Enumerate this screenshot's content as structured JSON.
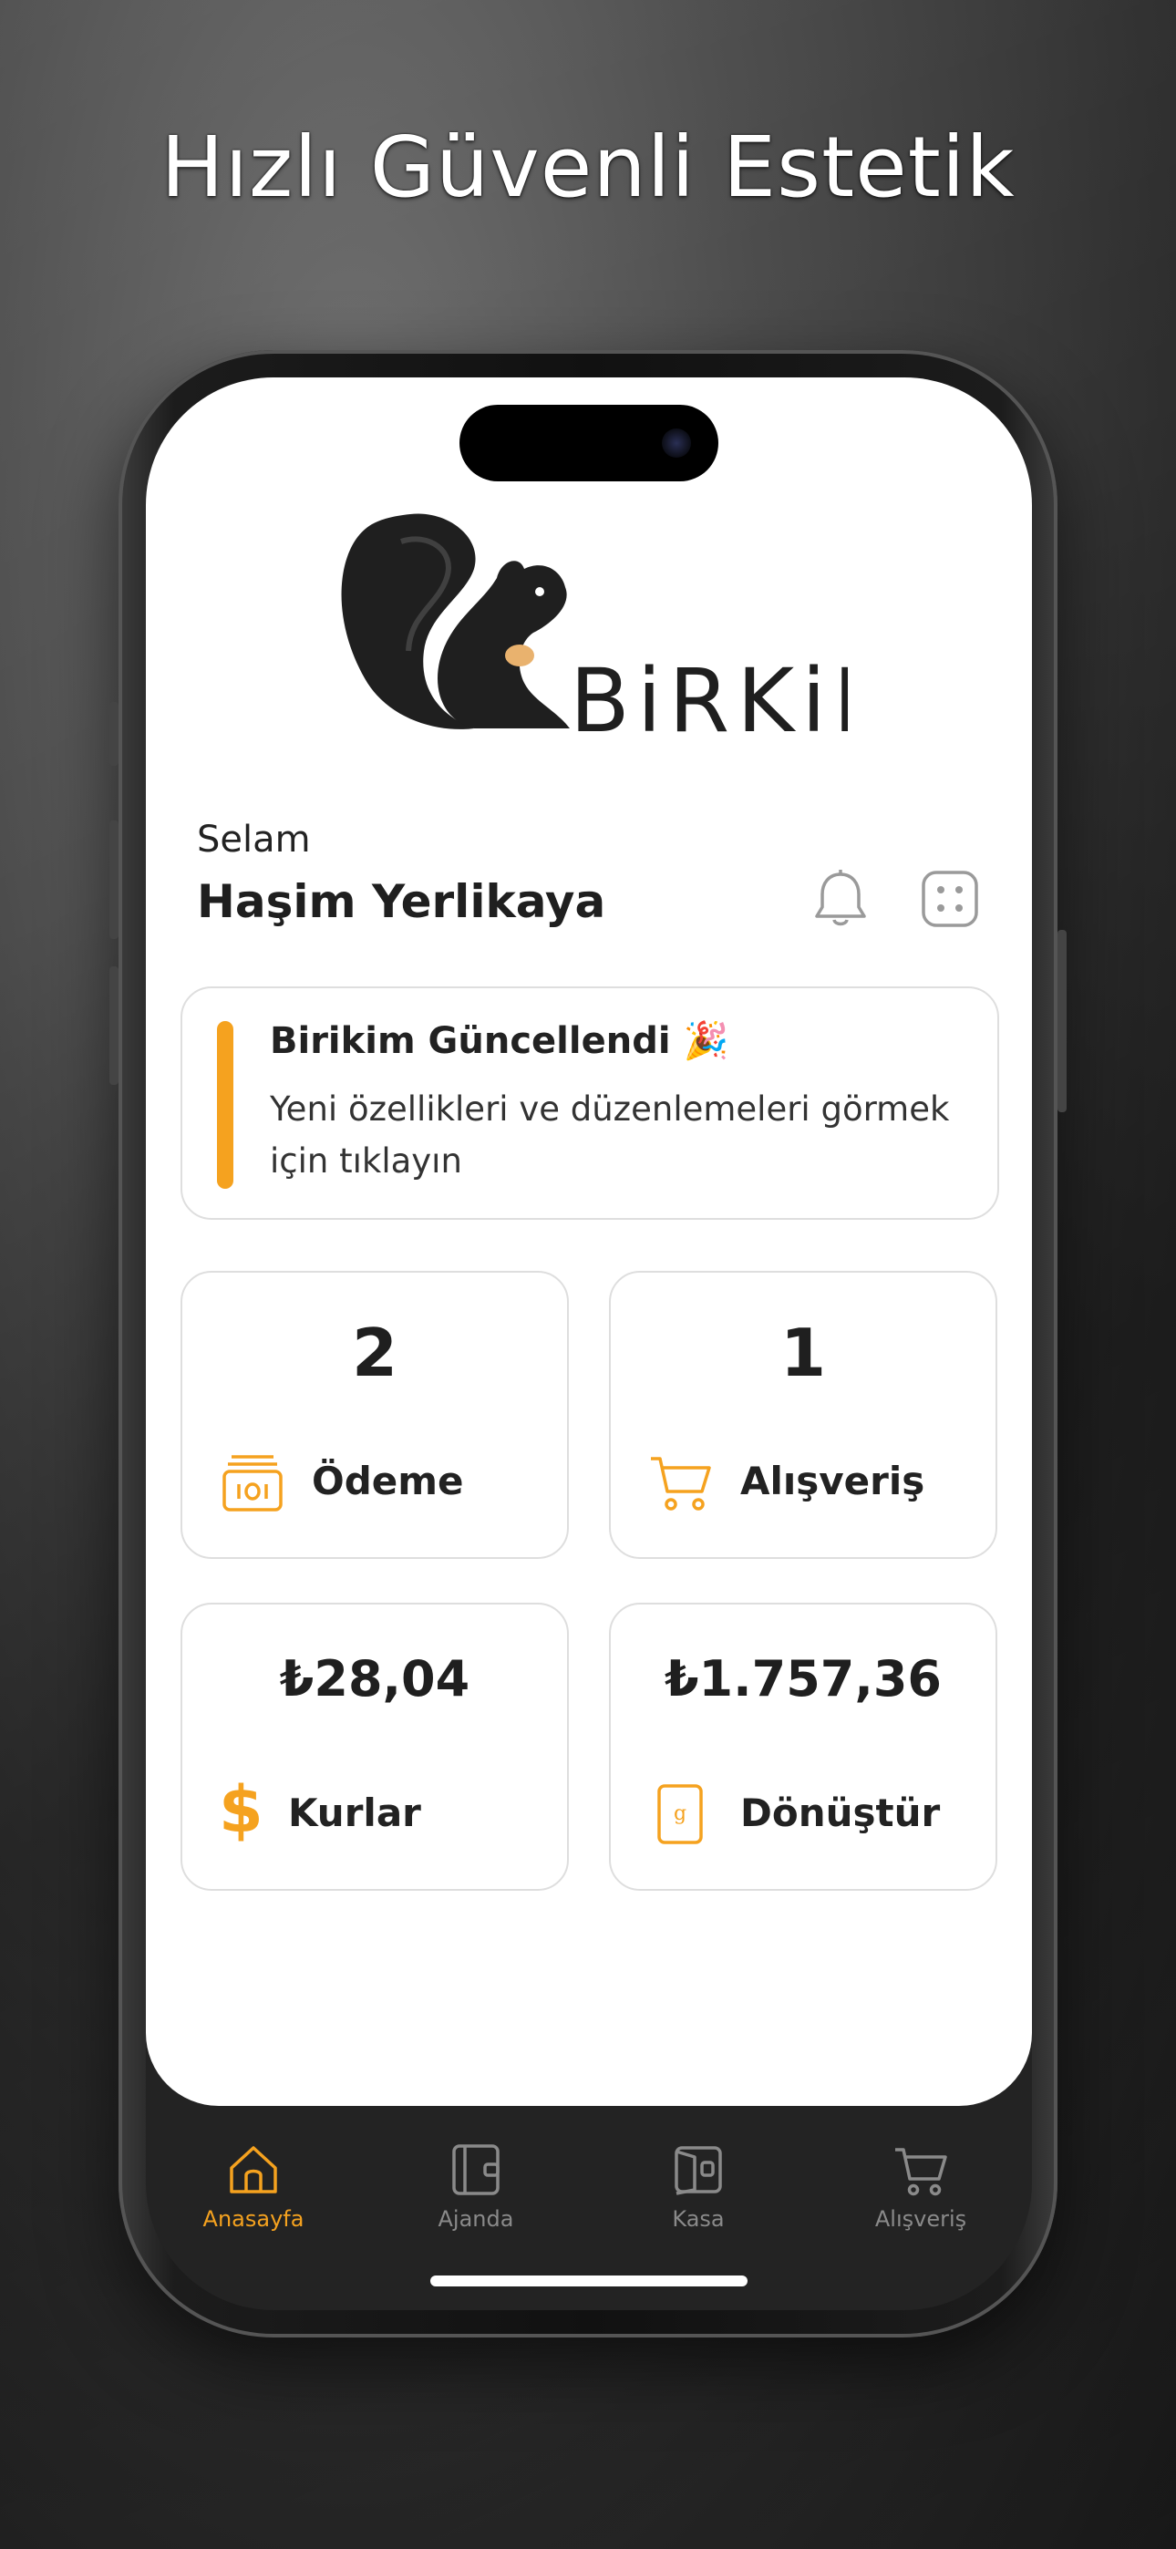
{
  "headline": "Hızlı Güvenli Estetik",
  "brand": {
    "logo_text": "BiRKiM"
  },
  "greeting": {
    "hello": "Selam",
    "name": "Haşim Yerlikaya"
  },
  "notice": {
    "title": "Birikim Güncellendi 🎉",
    "body": "Yeni özellikleri ve düzenlemeleri görmek için tıklayın"
  },
  "tiles": [
    {
      "value": "2",
      "label": "Ödeme",
      "icon": "money-stack-icon"
    },
    {
      "value": "1",
      "label": "Alışveriş",
      "icon": "cart-icon"
    },
    {
      "value": "₺28,04",
      "label": "Kurlar",
      "icon": "dollar-icon"
    },
    {
      "value": "₺1.757,36",
      "label": "Dönüştür",
      "icon": "gold-bar-icon"
    }
  ],
  "tabs": [
    {
      "label": "Anasayfa",
      "icon": "home-icon",
      "active": true
    },
    {
      "label": "Ajanda",
      "icon": "wallet-icon",
      "active": false
    },
    {
      "label": "Kasa",
      "icon": "safe-icon",
      "active": false
    },
    {
      "label": "Alışveriş",
      "icon": "cart-icon",
      "active": false
    }
  ],
  "colors": {
    "accent": "#f5a21f",
    "tab_inactive": "#8a8a8a",
    "tabbar_bg": "#232323",
    "text": "#1f1f1f"
  }
}
